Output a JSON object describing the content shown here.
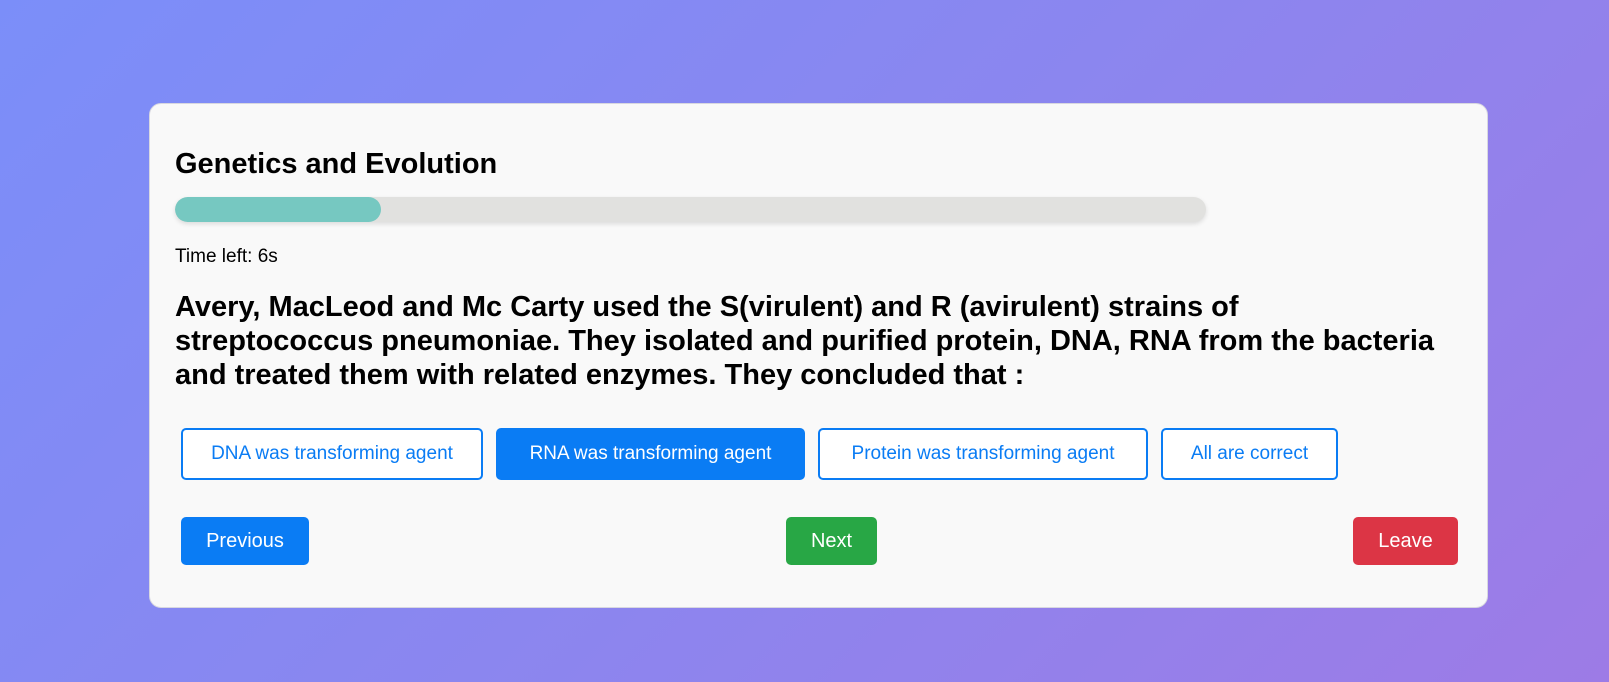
{
  "quiz": {
    "title": "Genetics and Evolution",
    "progress_fraction": 0.2,
    "timer_text": "Time left: 6s"
  },
  "question": {
    "text": "Avery, MacLeod and Mc Carty used the S(virulent) and R (avirulent) strains of streptococcus pneumoniae. They isolated and purified protein, DNA, RNA from the bacteria and treated them with related enzymes. They concluded that :"
  },
  "options": [
    {
      "label": "DNA was transforming agent",
      "selected": false
    },
    {
      "label": "RNA was transforming agent",
      "selected": true
    },
    {
      "label": "Protein was transforming agent",
      "selected": false
    },
    {
      "label": "All are correct",
      "selected": false
    }
  ],
  "nav": {
    "previous_label": "Previous",
    "next_label": "Next",
    "leave_label": "Leave"
  },
  "colors": {
    "primary": "#0a7cf4",
    "success": "#28a745",
    "danger": "#dc3545",
    "progress_fill": "#76c8c1",
    "progress_track": "#e1e1df"
  }
}
